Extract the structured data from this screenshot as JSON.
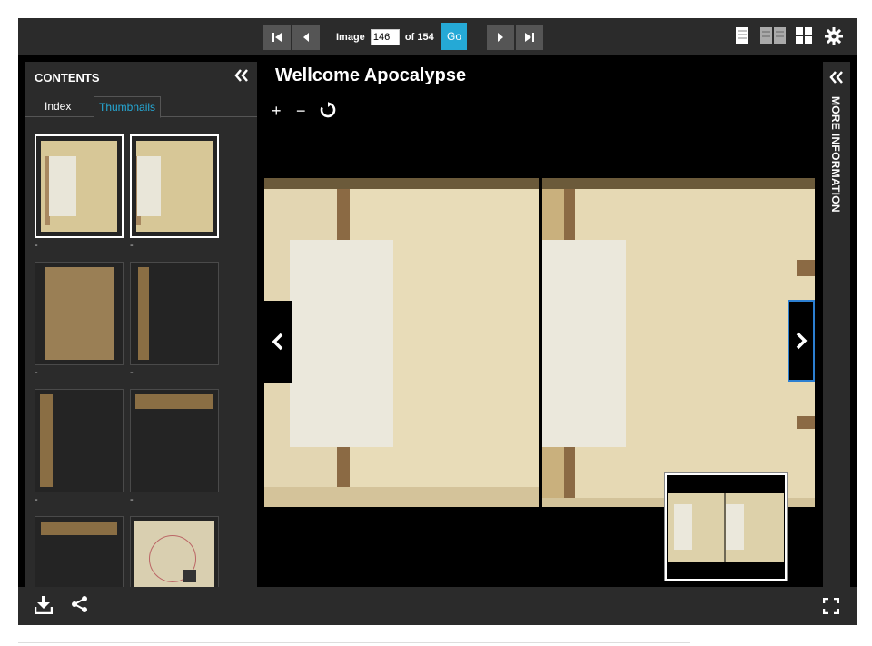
{
  "toolbar": {
    "image_label": "Image",
    "image_value": "146",
    "of_label": "of 154",
    "go_label": "Go"
  },
  "contents": {
    "title": "CONTENTS",
    "tabs": [
      {
        "label": "Index",
        "active": false
      },
      {
        "label": "Thumbnails",
        "active": true
      }
    ],
    "thumbnail_captions": [
      "-",
      "-",
      "-",
      "-",
      "-",
      "-"
    ]
  },
  "viewer": {
    "title": "Wellcome Apocalypse",
    "zoom_in": "+",
    "zoom_out": "−"
  },
  "more_info": {
    "label": "MORE INFORMATION"
  },
  "colors": {
    "accent": "#25a9d6",
    "panel": "#2b2b2b",
    "selected_nav_border": "#2c7fd1"
  },
  "icons": [
    "first-page-icon",
    "prev-page-icon",
    "next-page-icon",
    "last-page-icon",
    "one-up-icon",
    "two-up-icon",
    "gallery-icon",
    "settings-icon",
    "collapse-icon",
    "rotate-icon",
    "download-icon",
    "share-icon",
    "fullscreen-icon"
  ]
}
